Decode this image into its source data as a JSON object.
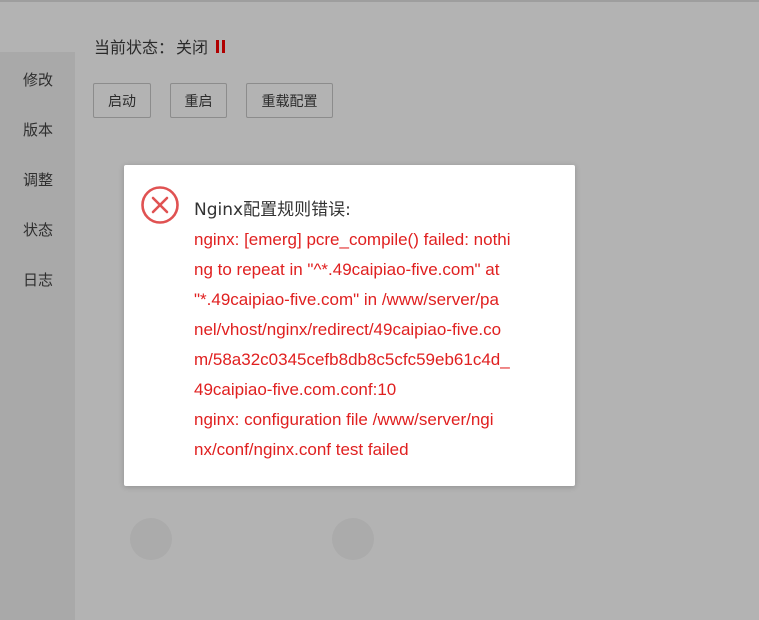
{
  "status": {
    "label": "当前状态：",
    "value": "关闭",
    "indicator_color": "#b00000"
  },
  "toolbar": {
    "start_label": "启动",
    "restart_label": "重启",
    "reload_label": "重载配置"
  },
  "sidebar": {
    "items": [
      {
        "label": "修改"
      },
      {
        "label": "版本"
      },
      {
        "label": "调整"
      },
      {
        "label": "状态"
      },
      {
        "label": "日志"
      }
    ]
  },
  "dialog": {
    "icon": "error-circle-icon",
    "accent_color": "#e02020",
    "title": "Nginx配置规则错误:",
    "lines": [
      "nginx: [emerg] pcre_compile() failed: nothi",
      "ng to repeat in \"^*.49caipiao-five.com\" at",
      "\"*.49caipiao-five.com\" in /www/server/pa",
      "nel/vhost/nginx/redirect/49caipiao-five.co",
      "m/58a32c0345cefb8db8c5cfc59eb61c4d_",
      "49caipiao-five.com.conf:10",
      "nginx: configuration file /www/server/ngi",
      "nx/conf/nginx.conf test failed"
    ]
  }
}
